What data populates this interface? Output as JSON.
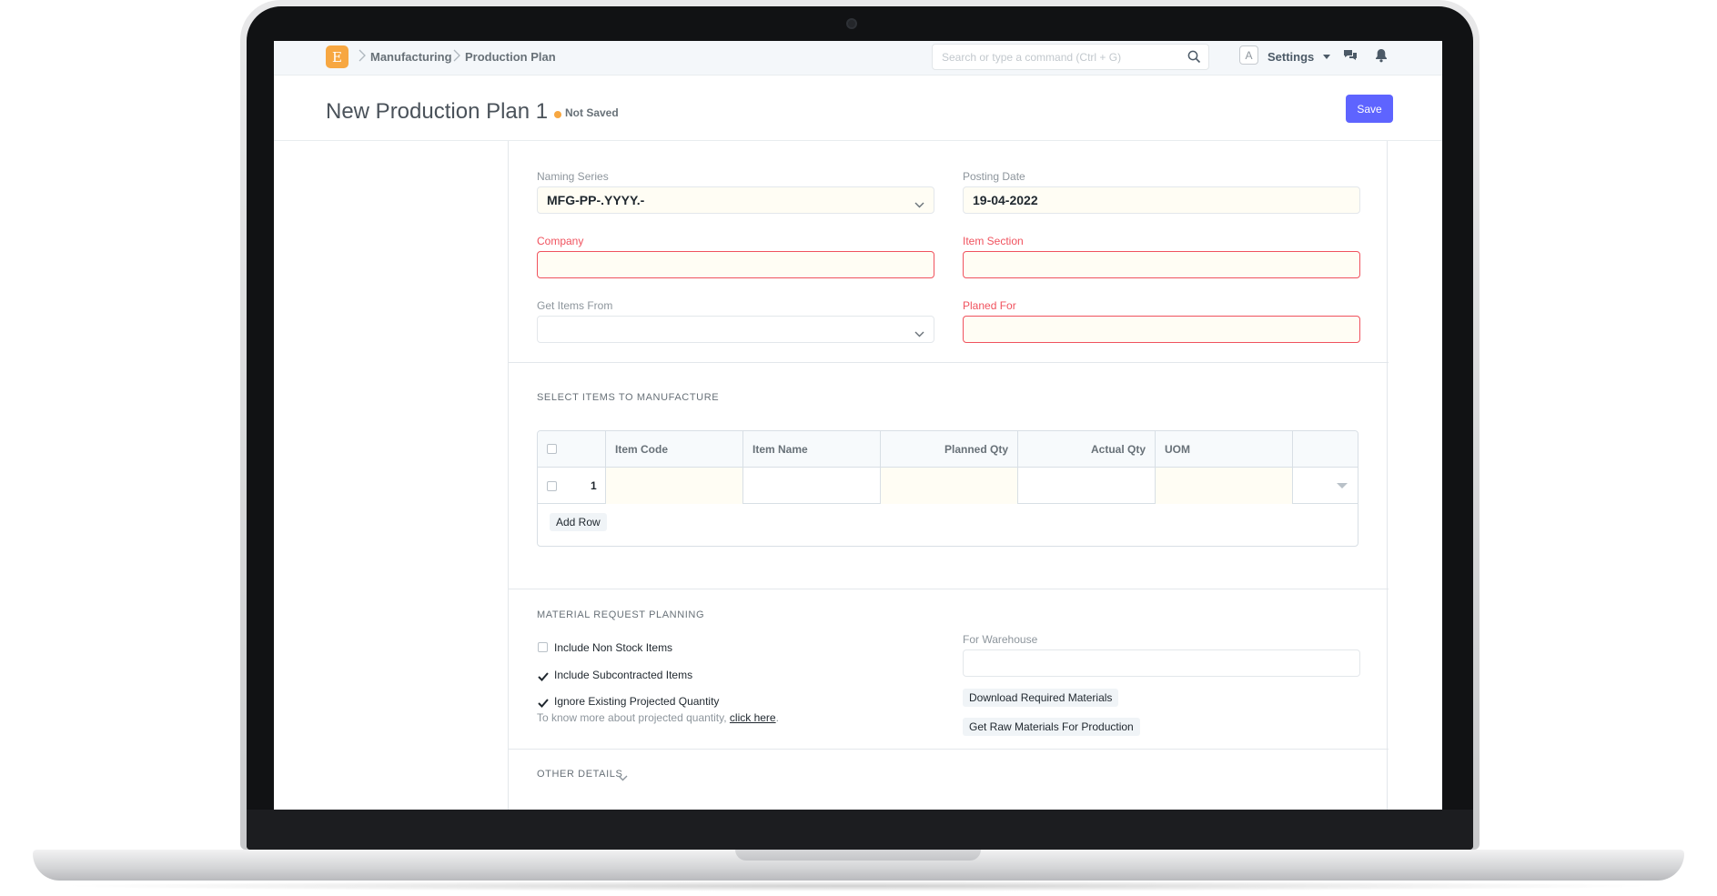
{
  "navbar": {
    "logo_letter": "E",
    "breadcrumbs": [
      "Manufacturing",
      "Production Plan"
    ],
    "search_placeholder": "Search or type a command (Ctrl + G)",
    "avatar_letter": "A",
    "settings_label": "Settings"
  },
  "header": {
    "title": "New Production Plan 1",
    "status": "Not Saved",
    "save_label": "Save",
    "accent_color": "#5e64ff",
    "status_color": "#f7a741"
  },
  "form": {
    "naming_series": {
      "label": "Naming Series",
      "value": "MFG-PP-.YYYY.-"
    },
    "posting_date": {
      "label": "Posting Date",
      "value": "19-04-2022"
    },
    "company": {
      "label": "Company",
      "value": ""
    },
    "item_section": {
      "label": "Item Section",
      "value": ""
    },
    "get_items_from": {
      "label": "Get Items From",
      "value": ""
    },
    "planed_for": {
      "label": "Planed For",
      "value": ""
    }
  },
  "items_section": {
    "title": "SELECT ITEMS TO MANUFACTURE",
    "columns": [
      "Item Code",
      "Item Name",
      "Planned Qty",
      "Actual Qty",
      "UOM"
    ],
    "rows": [
      {
        "idx": "1"
      }
    ],
    "add_row_label": "Add Row"
  },
  "material_section": {
    "title": "MATERIAL REQUEST PLANNING",
    "checks": [
      {
        "label": "Include Non Stock Items",
        "checked": false
      },
      {
        "label": "Include Subcontracted Items",
        "checked": true
      },
      {
        "label": "Ignore Existing Projected Quantity",
        "checked": true
      }
    ],
    "help_text": "To know more about projected quantity,",
    "help_link": "click here",
    "help_end": ".",
    "warehouse_label": "For Warehouse",
    "download_label": "Download Required Materials",
    "raw_materials_label": "Get Raw Materials For Production"
  },
  "other_section": {
    "title": "OTHER DETAILS"
  },
  "icons": [
    "logo-icon",
    "chevron-right-icon",
    "search-icon",
    "caret-down-icon",
    "chat-icon",
    "bell-icon",
    "check-icon",
    "chevron-down-icon"
  ]
}
